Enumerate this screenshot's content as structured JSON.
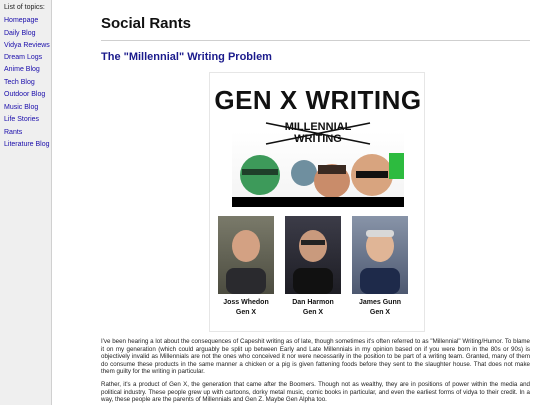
{
  "sidebar": {
    "heading": "List of topics:",
    "items": [
      {
        "label": "Homepage"
      },
      {
        "label": "Daily Blog"
      },
      {
        "label": "Vidya Reviews"
      },
      {
        "label": "Dream Logs"
      },
      {
        "label": "Anime Blog"
      },
      {
        "label": "Tech Blog"
      },
      {
        "label": "Outdoor Blog"
      },
      {
        "label": "Music Blog"
      },
      {
        "label": "Life Stories"
      },
      {
        "label": "Rants"
      },
      {
        "label": "Literature Blog"
      }
    ]
  },
  "page": {
    "title": "Social Rants",
    "post_title": "The \"Millennial\" Writing Problem"
  },
  "figure": {
    "heading": "GEN X WRITING",
    "struck_line1": "MILLENNIAL",
    "struck_line2": "WRITING",
    "people": [
      {
        "name": "Joss Whedon",
        "gen": "Gen X"
      },
      {
        "name": "Dan Harmon",
        "gen": "Gen X"
      },
      {
        "name": "James Gunn",
        "gen": "Gen X"
      }
    ]
  },
  "body": {
    "paragraph1": "I've been hearing a lot about the consequences of Capeshit writing as of late, though sometimes it's often referred to as \"Millennial\" Writing/Humor. To blame it on my generation (which could arguably be split up between Early and Late Millennials in my opinion based on if you were born in the 80s or 90s) is objectively invalid as Millennials are not the ones who conceived it nor were necessarily in the position to be part of a writing team. Granted, many of them do consume these products in the same manner a chicken or a pig is given fattening foods before they sent to the slaughter house. That does not make them guilty for the writing in particular.",
    "paragraph2": "Rather, it's a product of Gen X, the generation that came after the Boomers. Though not as wealthy, they are in positions of power within the media and political industry. These people grew up with cartoons, dorky metal music, comic books in particular, and even the earliest forms of vidya to their credit. In a way, these people are the parents of Millennials and Gen Z. Maybe Gen Alpha too."
  }
}
